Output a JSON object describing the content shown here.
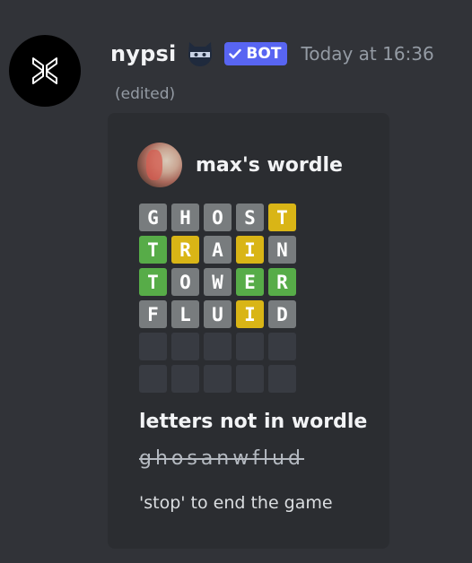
{
  "message": {
    "username": "nypsi",
    "role_icon": "ninja-mask-icon",
    "bot_tag": {
      "label": "BOT",
      "icon": "checkmark-icon",
      "color": "#5865f2"
    },
    "timestamp": "Today at 16:36",
    "edited_label": "(edited)"
  },
  "embed": {
    "author_name": "max's wordle",
    "board": [
      [
        {
          "letter": "G",
          "state": "gray"
        },
        {
          "letter": "H",
          "state": "gray"
        },
        {
          "letter": "O",
          "state": "gray"
        },
        {
          "letter": "S",
          "state": "gray"
        },
        {
          "letter": "T",
          "state": "yellow"
        }
      ],
      [
        {
          "letter": "T",
          "state": "green"
        },
        {
          "letter": "R",
          "state": "yellow"
        },
        {
          "letter": "A",
          "state": "gray"
        },
        {
          "letter": "I",
          "state": "yellow"
        },
        {
          "letter": "N",
          "state": "gray"
        }
      ],
      [
        {
          "letter": "T",
          "state": "green"
        },
        {
          "letter": "O",
          "state": "gray"
        },
        {
          "letter": "W",
          "state": "gray"
        },
        {
          "letter": "E",
          "state": "green"
        },
        {
          "letter": "R",
          "state": "green"
        }
      ],
      [
        {
          "letter": "F",
          "state": "gray"
        },
        {
          "letter": "L",
          "state": "gray"
        },
        {
          "letter": "U",
          "state": "gray"
        },
        {
          "letter": "I",
          "state": "yellow"
        },
        {
          "letter": "D",
          "state": "gray"
        }
      ],
      [
        {
          "letter": "",
          "state": "empty"
        },
        {
          "letter": "",
          "state": "empty"
        },
        {
          "letter": "",
          "state": "empty"
        },
        {
          "letter": "",
          "state": "empty"
        },
        {
          "letter": "",
          "state": "empty"
        }
      ],
      [
        {
          "letter": "",
          "state": "empty"
        },
        {
          "letter": "",
          "state": "empty"
        },
        {
          "letter": "",
          "state": "empty"
        },
        {
          "letter": "",
          "state": "empty"
        },
        {
          "letter": "",
          "state": "empty"
        }
      ]
    ],
    "tile_colors": {
      "gray": "#787c7e",
      "green": "#57ac48",
      "yellow": "#d9b516",
      "empty": "#383b42"
    },
    "field_title": "letters not in wordle",
    "field_value": "ghosanwflud",
    "footer_text": "'stop' to end the game"
  }
}
